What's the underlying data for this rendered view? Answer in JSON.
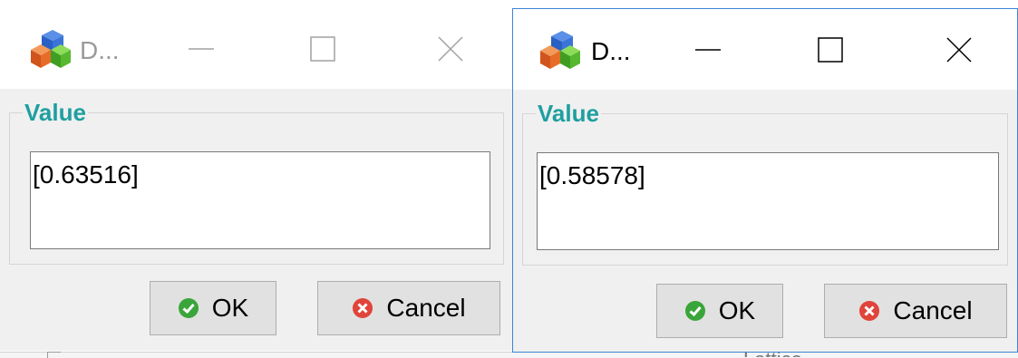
{
  "dialogs": [
    {
      "title": "D...",
      "active": false,
      "group_label": "Value",
      "value": "[0.63516]",
      "ok_label": "OK",
      "cancel_label": "Cancel"
    },
    {
      "title": "D...",
      "active": true,
      "group_label": "Value",
      "value": "[0.58578]",
      "ok_label": "OK",
      "cancel_label": "Cancel"
    }
  ],
  "background": {
    "fragment_text": "Lattice"
  },
  "colors": {
    "group_label": "#1f9fa0",
    "active_border": "#3c83d9",
    "ok_icon": "#3aa53a",
    "cancel_icon": "#e0443a",
    "dialog_bg": "#f0f0f0"
  },
  "icons": {
    "app": "cubes-icon",
    "minimize": "minimize-icon",
    "maximize": "maximize-icon",
    "close": "close-icon",
    "ok": "check-circle-icon",
    "cancel": "x-circle-icon"
  }
}
